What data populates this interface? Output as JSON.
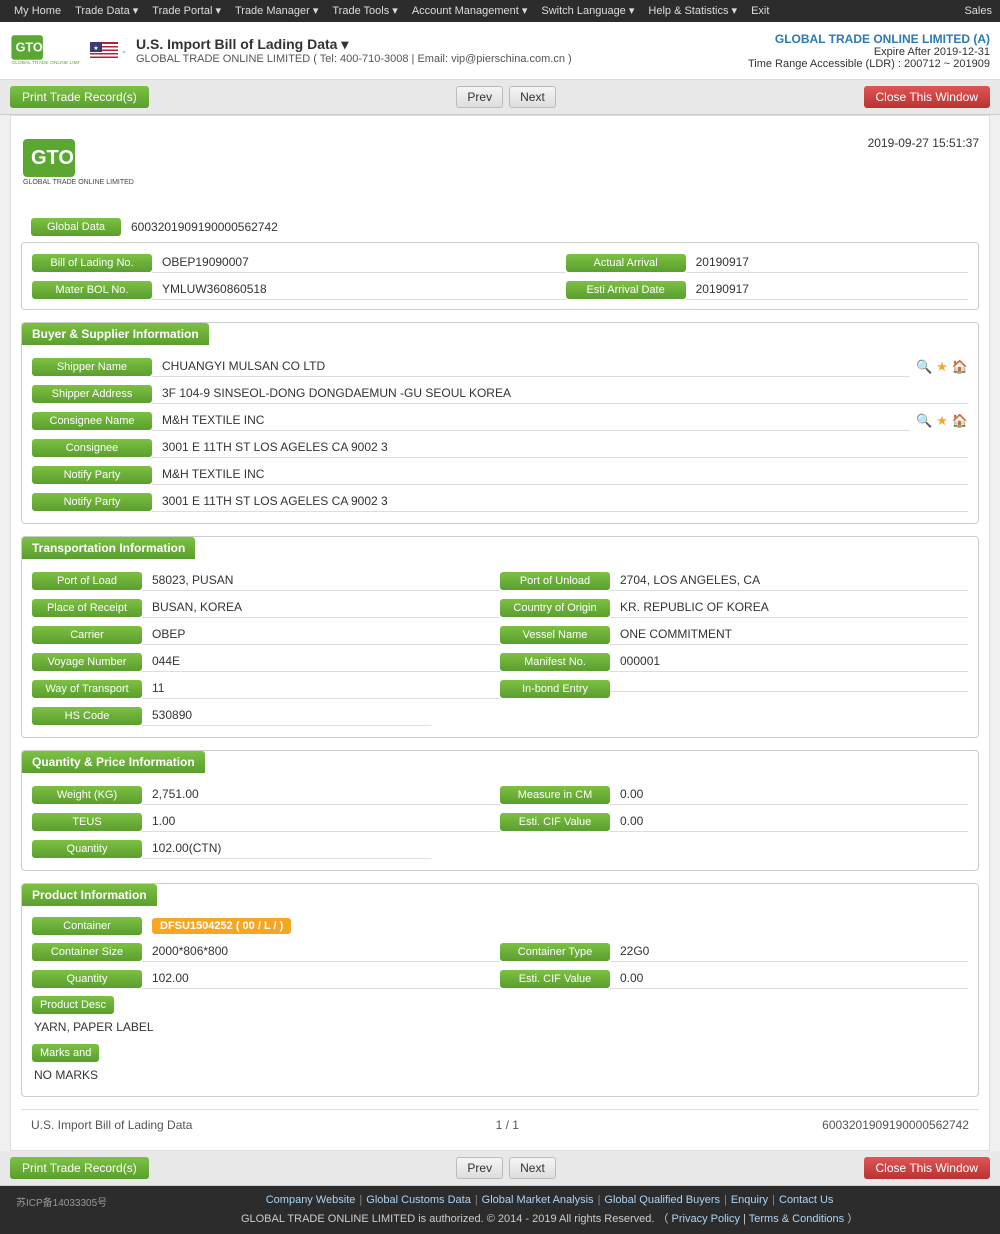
{
  "nav": {
    "items": [
      "My Home",
      "Trade Data",
      "Trade Portal",
      "Trade Manager",
      "Trade Tools",
      "Account Management",
      "Switch Language",
      "Help & Statistics",
      "Exit"
    ],
    "right": "Sales"
  },
  "header": {
    "title": "U.S. Import Bill of Lading Data ▾",
    "subtitle_company": "GLOBAL TRADE ONLINE LIMITED",
    "subtitle_contact": "( Tel: 400-710-3008 | Email: vip@pierschina.com.cn )",
    "company_name": "GLOBAL TRADE ONLINE LIMITED (A)",
    "expire_label": "Expire After 2019-12-31",
    "time_range": "Time Range Accessible (LDR) : 200712 ~ 201909"
  },
  "toolbar": {
    "print_btn": "Print Trade Record(s)",
    "prev_btn": "Prev",
    "next_btn": "Next",
    "close_btn": "Close This Window"
  },
  "doc": {
    "timestamp": "2019-09-27 15:51:37",
    "global_data_label": "Global Data",
    "global_data_value": "6003201909190000562742",
    "bol_label": "Bill of Lading No.",
    "bol_value": "OBEP19090007",
    "actual_arrival_label": "Actual Arrival",
    "actual_arrival_value": "20190917",
    "master_bol_label": "Mater BOL No.",
    "master_bol_value": "YMLUW360860518",
    "esti_arrival_label": "Esti Arrival Date",
    "esti_arrival_value": "20190917",
    "buyer_section_title": "Buyer & Supplier Information",
    "shipper_name_label": "Shipper Name",
    "shipper_name_value": "CHUANGYI MULSAN CO LTD",
    "shipper_address_label": "Shipper Address",
    "shipper_address_value": "3F 104-9 SINSEOL-DONG DONGDAEMUN -GU SEOUL KOREA",
    "consignee_name_label": "Consignee Name",
    "consignee_name_value": "M&H TEXTILE INC",
    "consignee_label": "Consignee",
    "consignee_value": "3001 E 11TH ST LOS AGELES CA 9002 3",
    "notify_party_label": "Notify Party",
    "notify_party_value": "M&H TEXTILE INC",
    "notify_party2_label": "Notify Party",
    "notify_party2_value": "3001 E 11TH ST LOS AGELES CA 9002 3",
    "transport_section_title": "Transportation Information",
    "port_of_load_label": "Port of Load",
    "port_of_load_value": "58023, PUSAN",
    "port_of_unload_label": "Port of Unload",
    "port_of_unload_value": "2704, LOS ANGELES, CA",
    "place_of_receipt_label": "Place of Receipt",
    "place_of_receipt_value": "BUSAN, KOREA",
    "country_of_origin_label": "Country of Origin",
    "country_of_origin_value": "KR. REPUBLIC OF KOREA",
    "carrier_label": "Carrier",
    "carrier_value": "OBEP",
    "vessel_name_label": "Vessel Name",
    "vessel_name_value": "ONE COMMITMENT",
    "voyage_number_label": "Voyage Number",
    "voyage_number_value": "044E",
    "manifest_no_label": "Manifest No.",
    "manifest_no_value": "000001",
    "way_of_transport_label": "Way of Transport",
    "way_of_transport_value": "11",
    "inbond_entry_label": "In-bond Entry",
    "inbond_entry_value": "",
    "hs_code_label": "HS Code",
    "hs_code_value": "530890",
    "quantity_section_title": "Quantity & Price Information",
    "weight_label": "Weight (KG)",
    "weight_value": "2,751.00",
    "measure_cm_label": "Measure in CM",
    "measure_cm_value": "0.00",
    "teus_label": "TEUS",
    "teus_value": "1.00",
    "esti_cif_label": "Esti. CIF Value",
    "esti_cif_value": "0.00",
    "quantity_label": "Quantity",
    "quantity_value": "102.00(CTN)",
    "product_section_title": "Product Information",
    "container_label": "Container",
    "container_tag": "DFSU1504252 ( 00 / L / )",
    "container_size_label": "Container Size",
    "container_size_value": "2000*806*800",
    "container_type_label": "Container Type",
    "container_type_value": "22G0",
    "product_quantity_label": "Quantity",
    "product_quantity_value": "102.00",
    "product_esti_cif_label": "Esti. CIF Value",
    "product_esti_cif_value": "0.00",
    "product_desc_label": "Product Desc",
    "product_desc_value": "YARN, PAPER LABEL",
    "marks_label": "Marks and",
    "marks_value": "NO MARKS",
    "footer_title": "U.S. Import Bill of Lading Data",
    "footer_page": "1 / 1",
    "footer_global": "6003201909190000562742"
  },
  "footer": {
    "icp": "苏ICP备14033305号",
    "links": [
      "Company Website",
      "Global Customs Data",
      "Global Market Analysis",
      "Global Qualified Buyers",
      "Enquiry",
      "Contact Us"
    ],
    "copyright": "GLOBAL TRADE ONLINE LIMITED is authorized. © 2014 - 2019 All rights Reserved.  （",
    "privacy": "Privacy Policy",
    "terms": "Terms & Conditions",
    "copyright_end": "）"
  }
}
